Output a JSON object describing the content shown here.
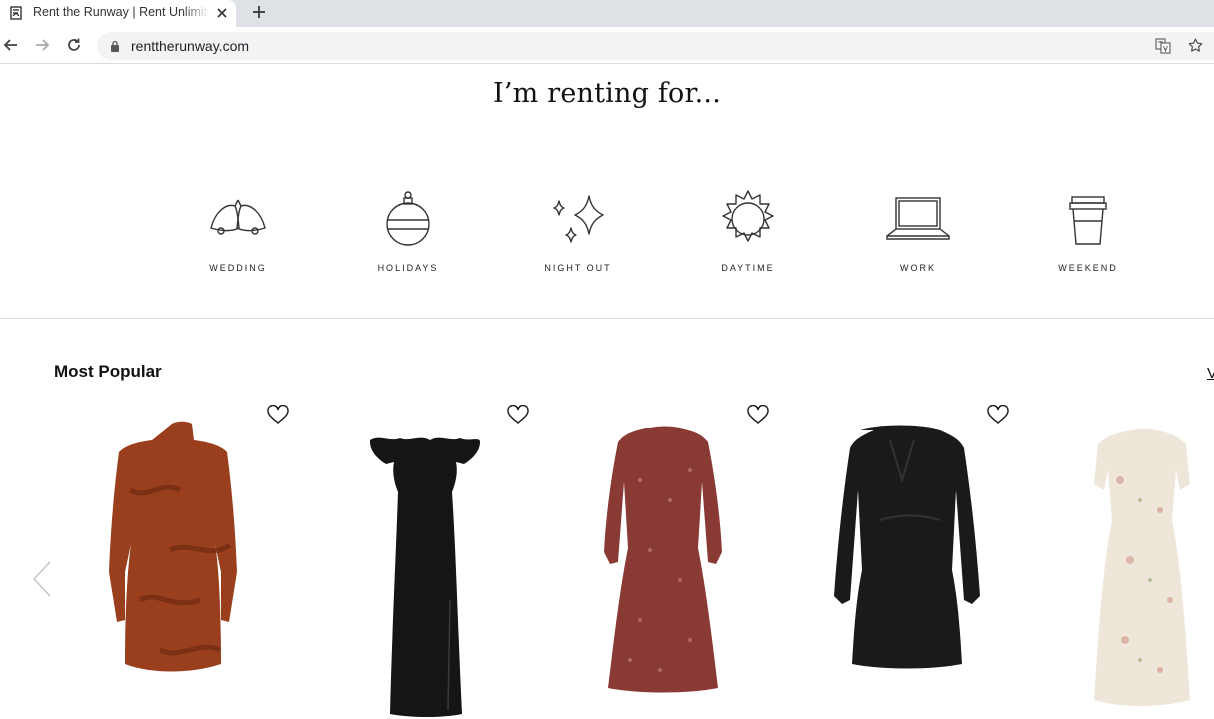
{
  "browser": {
    "tab_title": "Rent the Runway | Rent Unlimited",
    "url": "renttherunway.com"
  },
  "hero": {
    "title": "I’m renting for..."
  },
  "occasions": [
    {
      "label": "WEDDING",
      "icon": "wedding-bells-icon"
    },
    {
      "label": "HOLIDAYS",
      "icon": "ornament-icon"
    },
    {
      "label": "NIGHT OUT",
      "icon": "sparkle-icon"
    },
    {
      "label": "DAYTIME",
      "icon": "sun-icon"
    },
    {
      "label": "WORK",
      "icon": "laptop-icon"
    },
    {
      "label": "WEEKEND",
      "icon": "coffee-cup-icon"
    }
  ],
  "most_popular": {
    "title": "Most Popular",
    "view_all": "V",
    "products": [
      {
        "name": "rust velvet mini dress",
        "color": "#9a3f1e"
      },
      {
        "name": "black off-shoulder gown",
        "color": "#151515"
      },
      {
        "name": "red print midi dress",
        "color": "#8a3a35"
      },
      {
        "name": "black wrap dress",
        "color": "#1a1a1a"
      },
      {
        "name": "floral maxi dress",
        "color": "#efe6da"
      }
    ]
  },
  "colors": {
    "tabbar": "#dee1e6",
    "omnibox": "#f1f3f4",
    "divider": "#d9d9d9"
  }
}
